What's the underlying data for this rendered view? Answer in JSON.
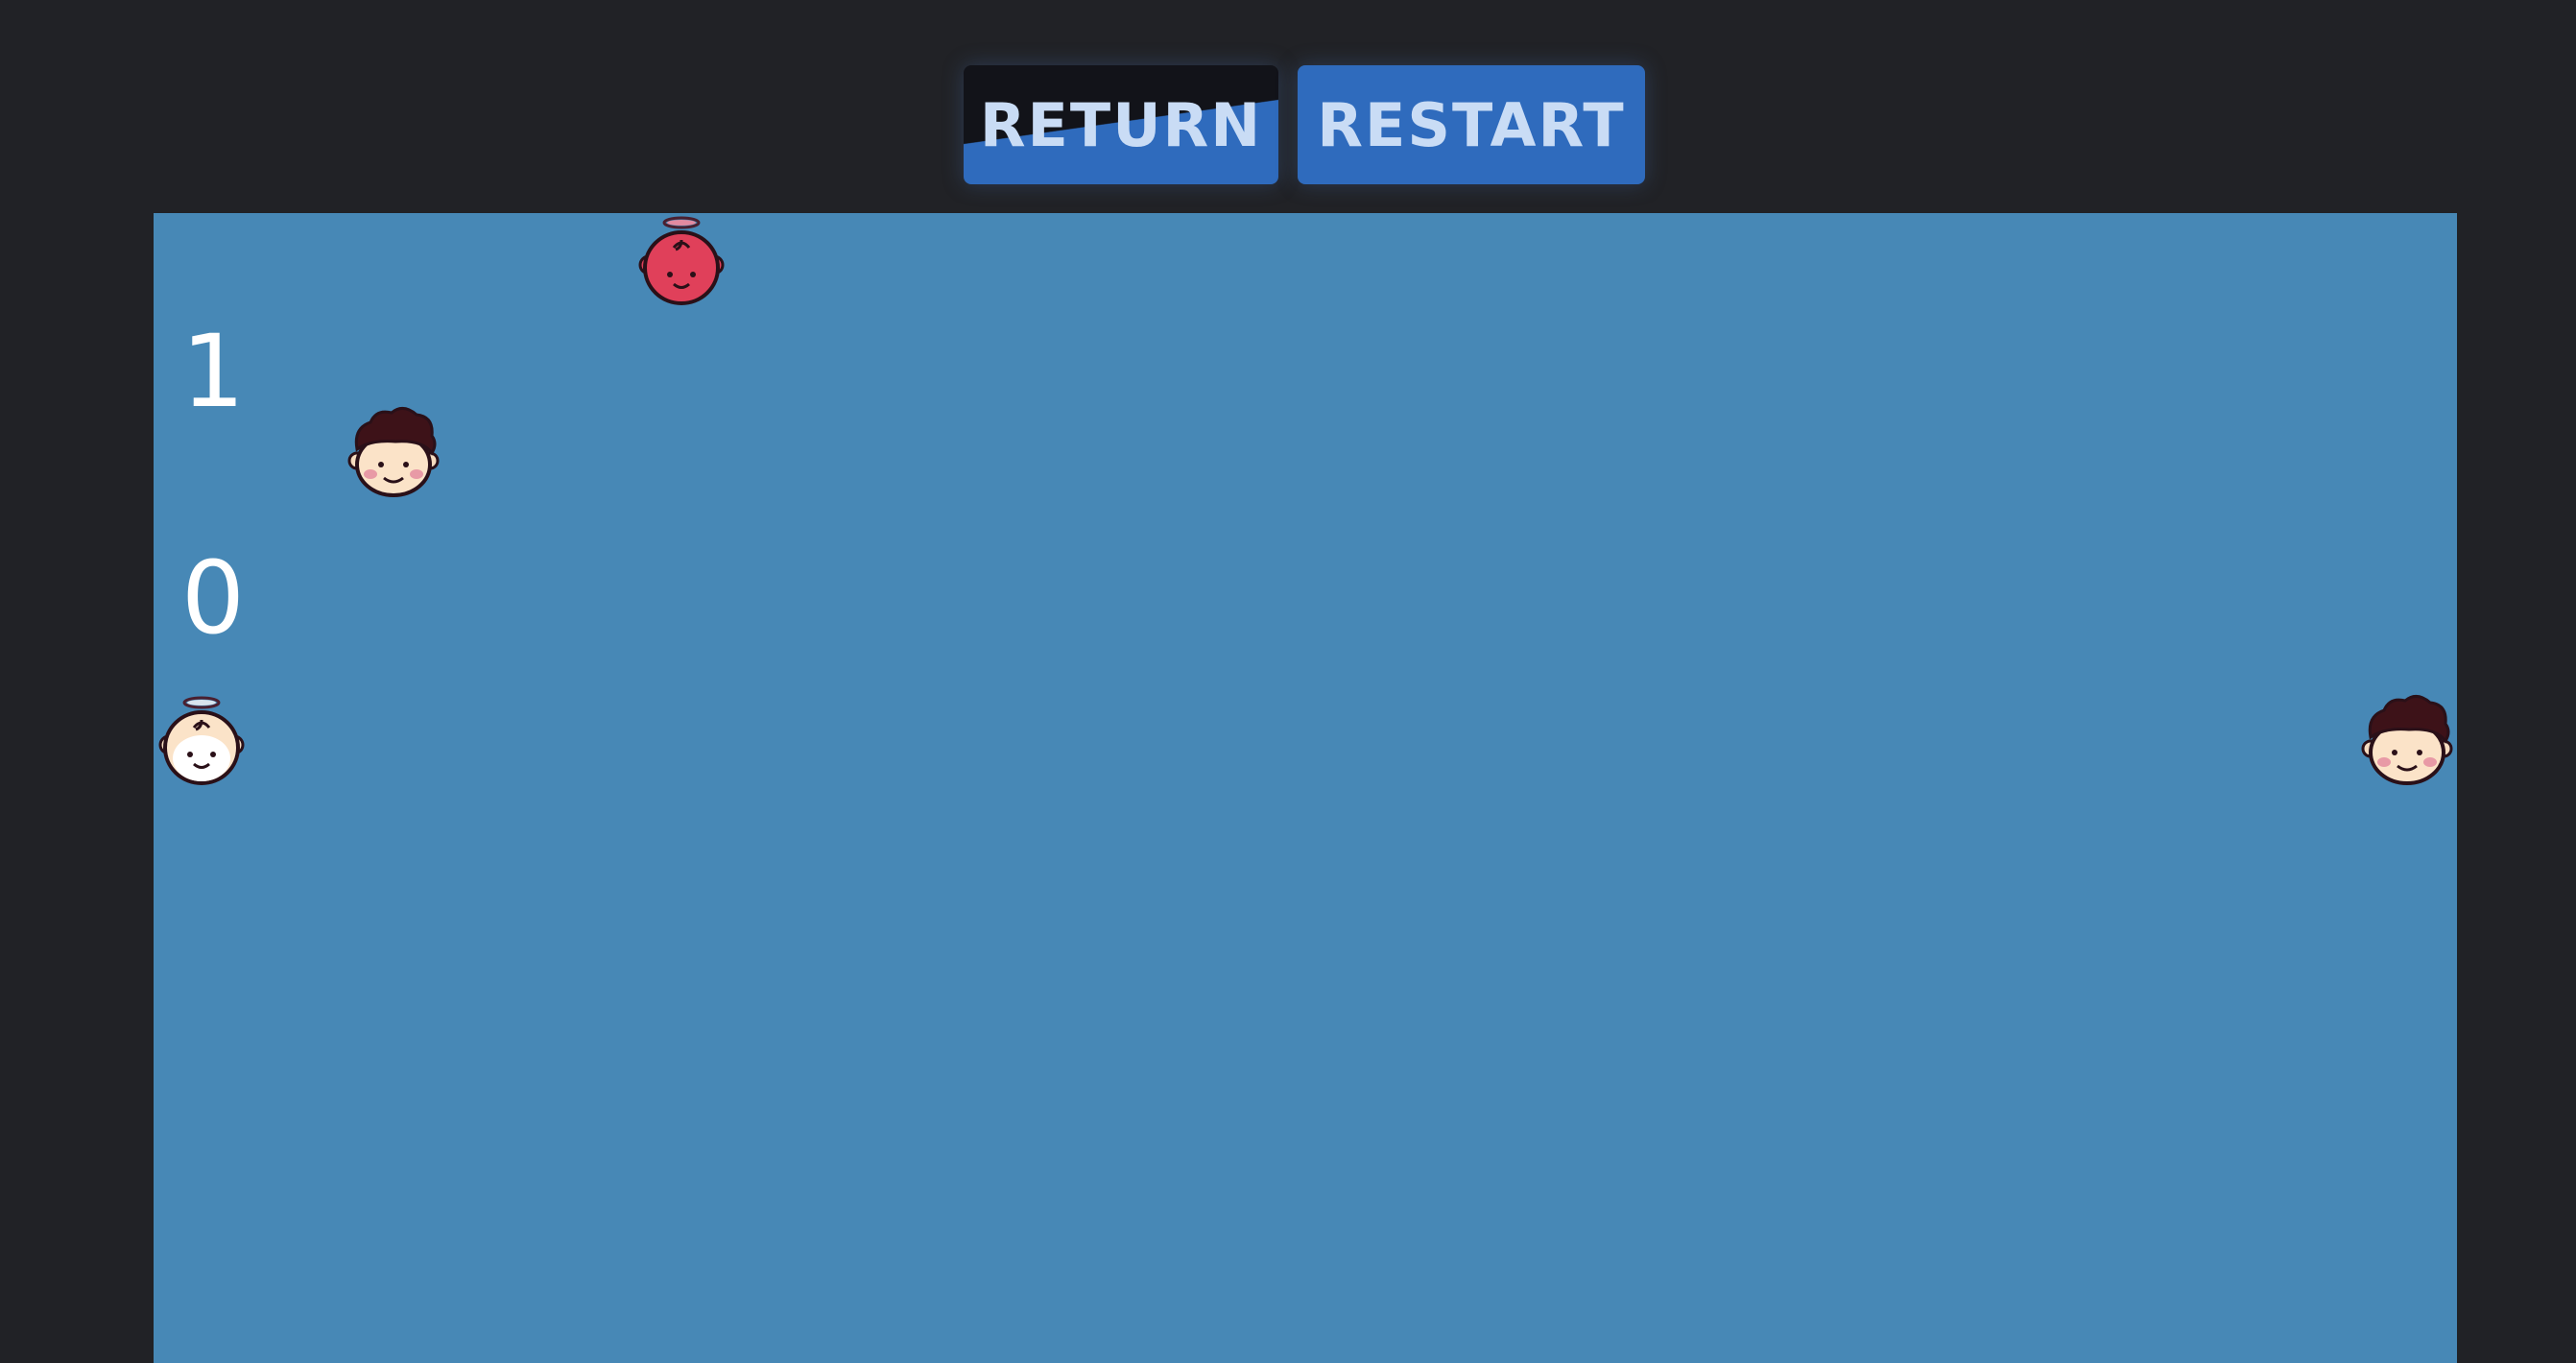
{
  "header": {
    "return_label": "RETURN",
    "restart_label": "RESTART"
  },
  "scoreboard": {
    "top_digit": "1",
    "bottom_digit": "0"
  },
  "characters": [
    {
      "name": "angel-red-icon",
      "type": "angel",
      "color": "#e0405a"
    },
    {
      "name": "boy-curly-hair-icon",
      "type": "boy"
    },
    {
      "name": "angel-white-icon",
      "type": "angel",
      "color": "#ffffff"
    },
    {
      "name": "boy-curly-hair-icon",
      "type": "boy"
    }
  ],
  "colors": {
    "background": "#212226",
    "board": "#4788b6",
    "button": "#2f6bbd",
    "button_text": "#c9dcf5"
  }
}
